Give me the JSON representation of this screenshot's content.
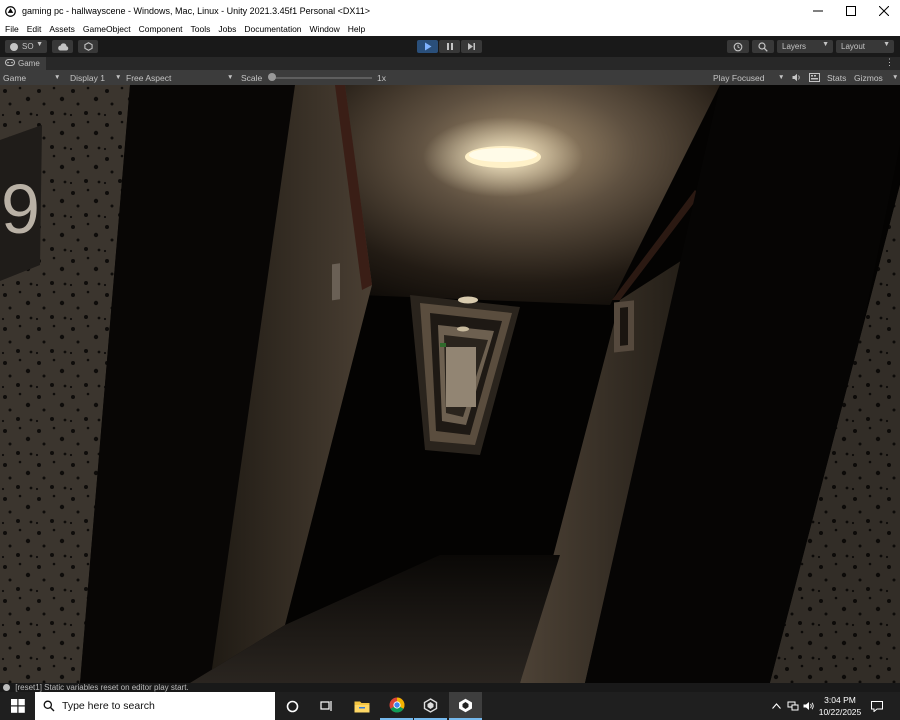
{
  "window": {
    "title": "gaming pc - hallwayscene - Windows, Mac, Linux - Unity 2021.3.45f1 Personal <DX11>",
    "controls": [
      "minimize-icon",
      "maximize-icon",
      "close-icon"
    ]
  },
  "menu": {
    "items": [
      "File",
      "Edit",
      "Assets",
      "GameObject",
      "Component",
      "Tools",
      "Jobs",
      "Documentation",
      "Window",
      "Help"
    ]
  },
  "toolbar": {
    "account_label": "SO",
    "play_icon": "play-icon",
    "pause_icon": "pause-icon",
    "step_icon": "step-icon",
    "layers_label": "Layers",
    "layout_label": "Layout",
    "play_active_color": "#2a4f7a"
  },
  "game_tab": {
    "label": "Game"
  },
  "game_toolbar": {
    "view_label": "Game",
    "display_label": "Display 1",
    "aspect_label": "Free Aspect",
    "scale_label": "Scale",
    "scale_value": "1x",
    "play_mode_label": "Play Focused",
    "stats_label": "Stats",
    "gizmos_label": "Gizmos"
  },
  "scene": {
    "door_number": "9",
    "lamp_color": "#fff1c8"
  },
  "console": {
    "message": "[reset1] Static variables reset on editor play start."
  },
  "taskbar": {
    "search_placeholder": "Type here to search",
    "apps": [
      "start-icon",
      "search-circle-icon",
      "task-view-icon",
      "file-explorer-icon",
      "chrome-icon",
      "unity-hub-icon",
      "unity-editor-icon"
    ],
    "clock_time": "3:04 PM",
    "clock_date": "10/22/2025"
  }
}
